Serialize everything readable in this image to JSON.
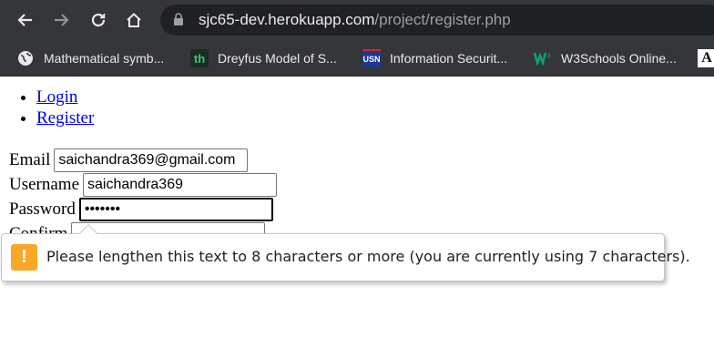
{
  "browser": {
    "url_host": "sjc65-dev.herokuapp.com",
    "url_path": "/project/register.php"
  },
  "bookmarks": [
    {
      "label": "Mathematical symb...",
      "icon": "globe-icon"
    },
    {
      "label": "Dreyfus Model of S...",
      "icon": "th"
    },
    {
      "label": "Information Securit...",
      "icon": "USN"
    },
    {
      "label": "W3Schools Online...",
      "icon": "W3"
    }
  ],
  "bookmark_overflow_icon": "A",
  "nav": {
    "links": [
      "Login",
      "Register"
    ]
  },
  "form": {
    "email_label": "Email",
    "email_value": "saichandra369@gmail.com",
    "username_label": "Username",
    "username_value": "saichandra369",
    "password_label": "Password",
    "password_value": "•••••••",
    "confirm_label": "Confirm"
  },
  "validation": {
    "icon": "!",
    "message": "Please lengthen this text to 8 characters or more (you are currently using 7 characters).",
    "color": "#f9a825"
  }
}
